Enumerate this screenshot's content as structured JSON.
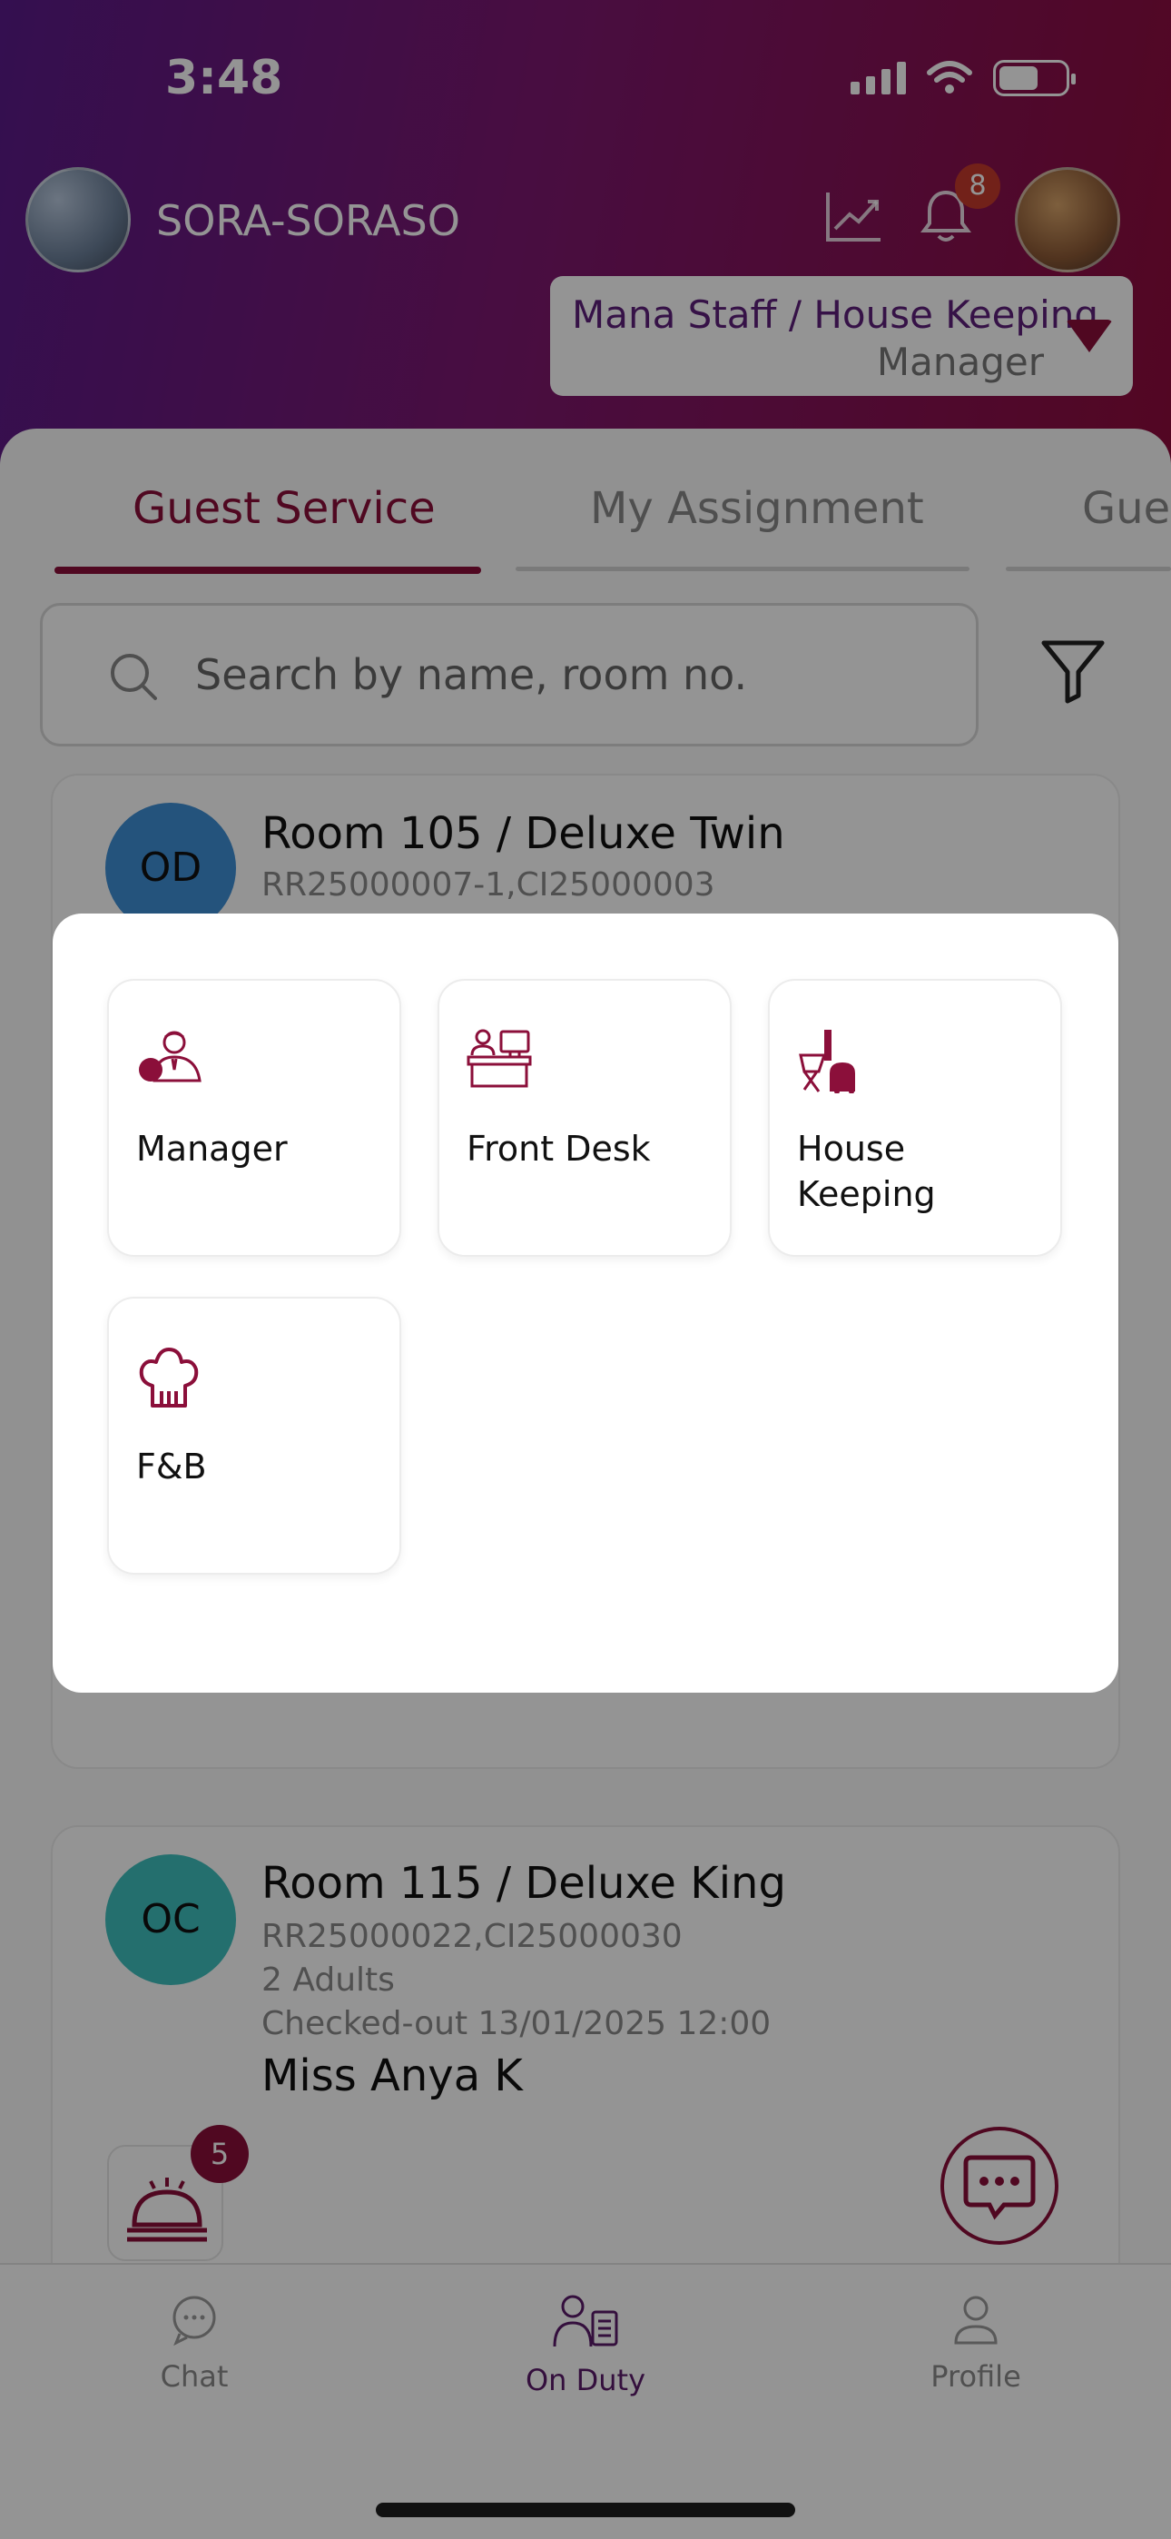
{
  "status_bar": {
    "time": "3:48"
  },
  "header": {
    "hotel_name": "SORA-SORASO",
    "notification_count": "8",
    "role_primary": "Mana Staff / House Keeping",
    "role_secondary": "Manager"
  },
  "tabs": [
    {
      "label": "Guest Service",
      "active": true
    },
    {
      "label": "My Assignment",
      "active": false
    },
    {
      "label": "Gue",
      "active": false
    }
  ],
  "search": {
    "placeholder": "Search by name, room no."
  },
  "cards": [
    {
      "initials": "OD",
      "title": "Room 105 / Deluxe Twin",
      "ref": "RR25000007-1,CI25000003"
    },
    {
      "initials": "OC",
      "title": "Room 115 / Deluxe King",
      "ref": "RR25000022,CI25000030",
      "adults": "2 Adults",
      "checkout": "Checked-out 13/01/2025 12:00",
      "guest": "Miss Anya K",
      "service_count": "5"
    }
  ],
  "bottom_nav": [
    {
      "label": "Chat",
      "icon": "chat-bubble-icon"
    },
    {
      "label": "On Duty",
      "icon": "on-duty-icon",
      "active": true
    },
    {
      "label": "Profile",
      "icon": "person-icon"
    }
  ],
  "department_picker": {
    "options": [
      {
        "label": "Manager",
        "icon": "manager-icon"
      },
      {
        "label": "Front Desk",
        "icon": "front-desk-icon"
      },
      {
        "label": "House Keeping",
        "icon": "housekeeping-icon"
      },
      {
        "label": "F&B",
        "icon": "chef-hat-icon"
      }
    ]
  },
  "colors": {
    "brand": "#8b0f3a",
    "header_purple": "#5a1a8a",
    "room_avatar_blue": "#3e8fd6",
    "room_avatar_teal": "#3fc0be"
  }
}
